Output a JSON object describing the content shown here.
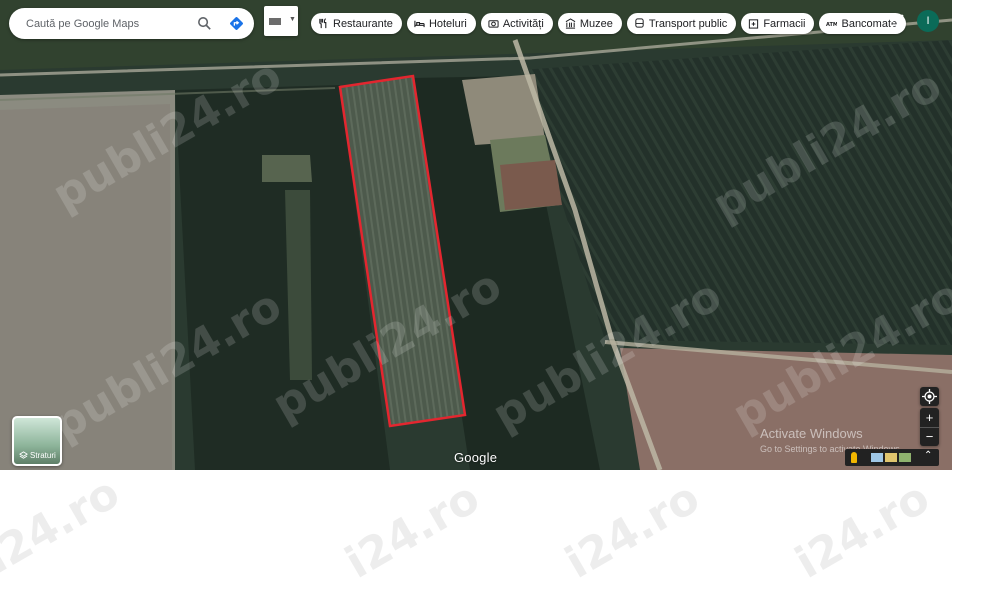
{
  "search": {
    "placeholder": "Caută pe Google Maps"
  },
  "chips": [
    {
      "label": "Restaurante",
      "icon": "fork-knife-icon"
    },
    {
      "label": "Hoteluri",
      "icon": "bed-icon"
    },
    {
      "label": "Activități",
      "icon": "camera-icon"
    },
    {
      "label": "Muzee",
      "icon": "museum-icon"
    },
    {
      "label": "Transport public",
      "icon": "bus-icon"
    },
    {
      "label": "Farmacii",
      "icon": "pharmacy-icon"
    },
    {
      "label": "Bancomate",
      "icon": "atm-icon"
    }
  ],
  "account": {
    "initial": "I"
  },
  "layers": {
    "label": "Straturi"
  },
  "map": {
    "logo": "Google",
    "highlight_color": "#e3262f"
  },
  "zoom": {
    "in": "+",
    "out": "−"
  },
  "system": {
    "activate_title": "Activate Windows",
    "activate_sub": "Go to Settings to activate Windows."
  },
  "watermark": {
    "text": "publi24.ro",
    "tail_text": "i24.ro"
  }
}
